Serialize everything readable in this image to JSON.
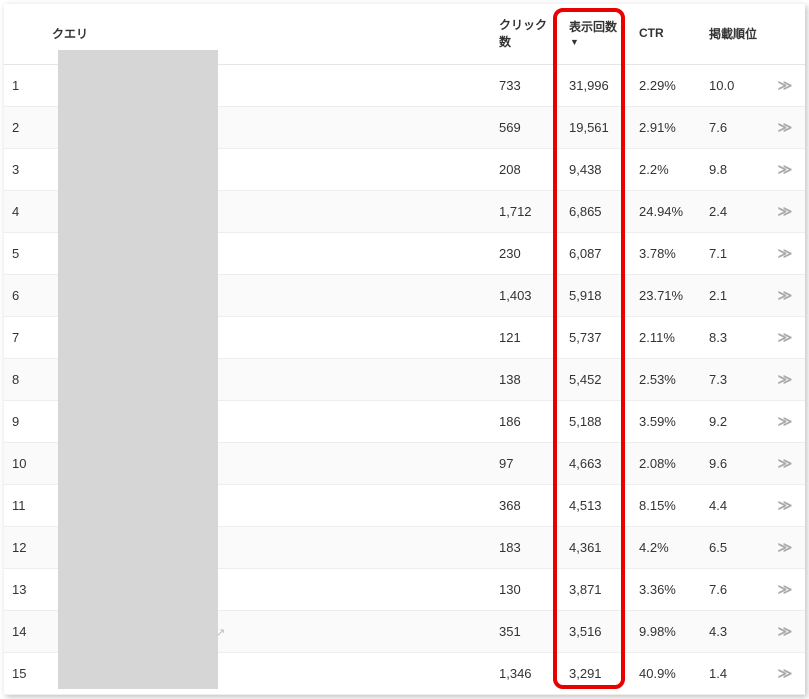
{
  "columns": {
    "query": "クエリ",
    "clicks": "クリック数",
    "impressions": "表示回数",
    "sort_indicator": "▼",
    "ctr": "CTR",
    "position": "掲載順位"
  },
  "rows": [
    {
      "num": "1",
      "clicks": "733",
      "impressions": "31,996",
      "ctr": "2.29%",
      "position": "10.0",
      "ext": false
    },
    {
      "num": "2",
      "clicks": "569",
      "impressions": "19,561",
      "ctr": "2.91%",
      "position": "7.6",
      "ext": false
    },
    {
      "num": "3",
      "clicks": "208",
      "impressions": "9,438",
      "ctr": "2.2%",
      "position": "9.8",
      "ext": false
    },
    {
      "num": "4",
      "clicks": "1,712",
      "impressions": "6,865",
      "ctr": "24.94%",
      "position": "2.4",
      "ext": false
    },
    {
      "num": "5",
      "clicks": "230",
      "impressions": "6,087",
      "ctr": "3.78%",
      "position": "7.1",
      "ext": false
    },
    {
      "num": "6",
      "clicks": "1,403",
      "impressions": "5,918",
      "ctr": "23.71%",
      "position": "2.1",
      "ext": false
    },
    {
      "num": "7",
      "clicks": "121",
      "impressions": "5,737",
      "ctr": "2.11%",
      "position": "8.3",
      "ext": false
    },
    {
      "num": "8",
      "clicks": "138",
      "impressions": "5,452",
      "ctr": "2.53%",
      "position": "7.3",
      "ext": false
    },
    {
      "num": "9",
      "clicks": "186",
      "impressions": "5,188",
      "ctr": "3.59%",
      "position": "9.2",
      "ext": false
    },
    {
      "num": "10",
      "clicks": "97",
      "impressions": "4,663",
      "ctr": "2.08%",
      "position": "9.6",
      "ext": false
    },
    {
      "num": "11",
      "clicks": "368",
      "impressions": "4,513",
      "ctr": "8.15%",
      "position": "4.4",
      "ext": false
    },
    {
      "num": "12",
      "clicks": "183",
      "impressions": "4,361",
      "ctr": "4.2%",
      "position": "6.5",
      "ext": false
    },
    {
      "num": "13",
      "clicks": "130",
      "impressions": "3,871",
      "ctr": "3.36%",
      "position": "7.6",
      "ext": false
    },
    {
      "num": "14",
      "clicks": "351",
      "impressions": "3,516",
      "ctr": "9.98%",
      "position": "4.3",
      "ext": true
    },
    {
      "num": "15",
      "clicks": "1,346",
      "impressions": "3,291",
      "ctr": "40.9%",
      "position": "1.4",
      "ext": false
    }
  ],
  "icons": {
    "chevron": "≫",
    "external": "↗"
  },
  "highlight_column": "impressions"
}
